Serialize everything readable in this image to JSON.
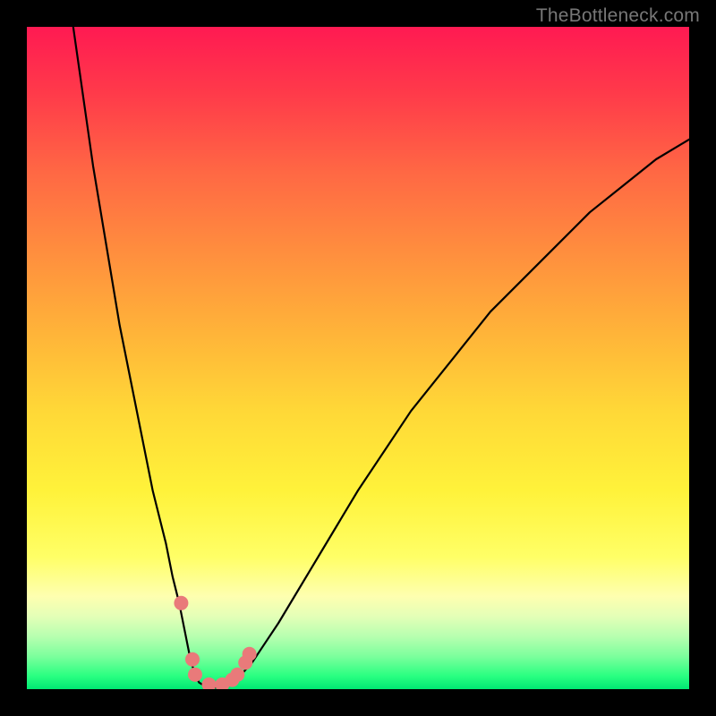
{
  "watermark": "TheBottleneck.com",
  "chart_data": {
    "type": "line",
    "title": "",
    "xlabel": "",
    "ylabel": "",
    "xlim": [
      0,
      100
    ],
    "ylim": [
      0,
      100
    ],
    "series": [
      {
        "name": "left-branch",
        "x": [
          7,
          8,
          9,
          10,
          11,
          12,
          13,
          14,
          15,
          16,
          17,
          18,
          19,
          20,
          21,
          22,
          23,
          24,
          24.5,
          25,
          25.5,
          26
        ],
        "y": [
          100,
          93,
          86,
          79,
          73,
          67,
          61,
          55,
          50,
          45,
          40,
          35,
          30,
          26,
          22,
          17,
          13,
          8,
          5.5,
          3.5,
          2,
          1
        ]
      },
      {
        "name": "valley",
        "x": [
          26,
          27,
          28,
          29,
          30,
          31,
          32
        ],
        "y": [
          1,
          0.4,
          0.2,
          0.3,
          0.6,
          1.1,
          1.8
        ]
      },
      {
        "name": "right-branch",
        "x": [
          32,
          34,
          36,
          38,
          41,
          44,
          47,
          50,
          54,
          58,
          62,
          66,
          70,
          75,
          80,
          85,
          90,
          95,
          100
        ],
        "y": [
          1.8,
          4,
          7,
          10,
          15,
          20,
          25,
          30,
          36,
          42,
          47,
          52,
          57,
          62,
          67,
          72,
          76,
          80,
          83
        ]
      }
    ],
    "markers": [
      {
        "name": "left-dot-1",
        "x": 23.3,
        "y": 13
      },
      {
        "name": "left-dot-2",
        "x": 25.0,
        "y": 4.5
      },
      {
        "name": "left-dot-3",
        "x": 25.4,
        "y": 2.2
      },
      {
        "name": "mid-dot-1",
        "x": 27.5,
        "y": 0.7
      },
      {
        "name": "mid-dot-2",
        "x": 29.5,
        "y": 0.7
      },
      {
        "name": "right-dot-1",
        "x": 31.0,
        "y": 1.4
      },
      {
        "name": "right-dot-2",
        "x": 31.8,
        "y": 2.2
      },
      {
        "name": "right-dot-3",
        "x": 33.0,
        "y": 4.0
      },
      {
        "name": "right-dot-4",
        "x": 33.6,
        "y": 5.3
      }
    ],
    "marker_color": "#e97a7a",
    "marker_radius_px": 8
  }
}
